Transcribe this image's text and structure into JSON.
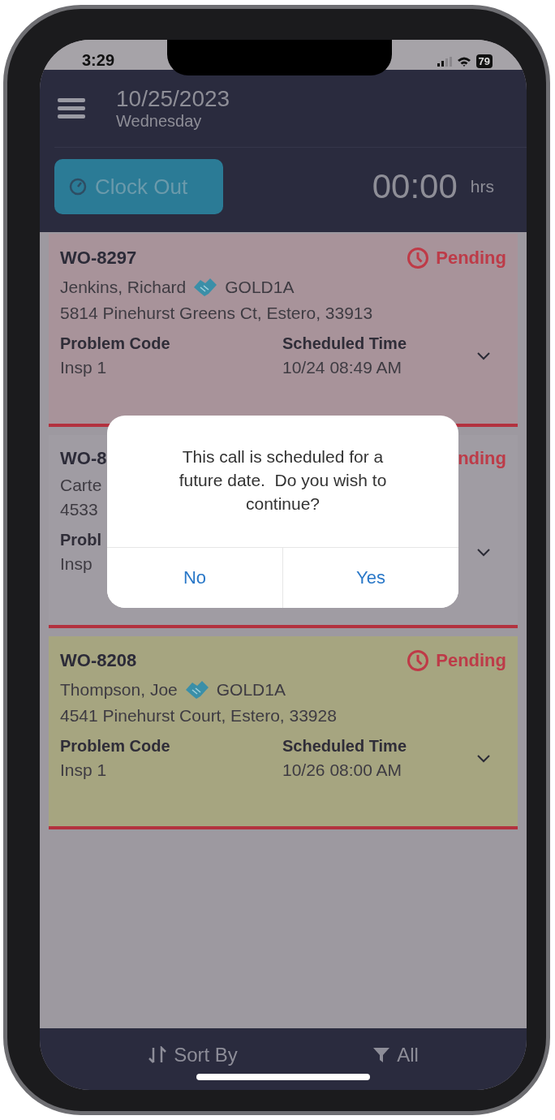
{
  "status_bar": {
    "time": "3:29",
    "battery": "79"
  },
  "header": {
    "date": "10/25/2023",
    "weekday": "Wednesday",
    "clock_button": "Clock Out",
    "hours": "00:00",
    "hours_unit": "hrs"
  },
  "work_orders": [
    {
      "id": "WO-8297",
      "status": "Pending",
      "status_icon": true,
      "customer": "Jenkins, Richard",
      "tag": "GOLD1A",
      "address": "5814 Pinehurst Greens Ct, Estero, 33913",
      "problem_label": "Problem Code",
      "problem_value": "Insp 1",
      "time_label": "Scheduled Time",
      "time_value": "10/24 08:49 AM",
      "color": "#a8939a"
    },
    {
      "id": "WO-8",
      "status": "nding",
      "customer": "Carte",
      "address": "4533",
      "problem_label": "Probl",
      "problem_value": "Insp",
      "color": "#a09ca3"
    },
    {
      "id": "WO-8208",
      "status": "Pending",
      "status_icon": true,
      "customer": "Thompson, Joe",
      "tag": "GOLD1A",
      "address": "4541 Pinehurst Court, Estero, 33928",
      "problem_label": "Problem Code",
      "problem_value": "Insp 1",
      "time_label": "Scheduled Time",
      "time_value": "10/26 08:00 AM",
      "color": "#a6a580"
    }
  ],
  "dialog": {
    "message": "This call is scheduled for a future date.  Do you wish to continue?",
    "buttons": [
      "No",
      "Yes"
    ]
  },
  "bottom_bar": {
    "sort": "Sort By",
    "filter": "All"
  }
}
